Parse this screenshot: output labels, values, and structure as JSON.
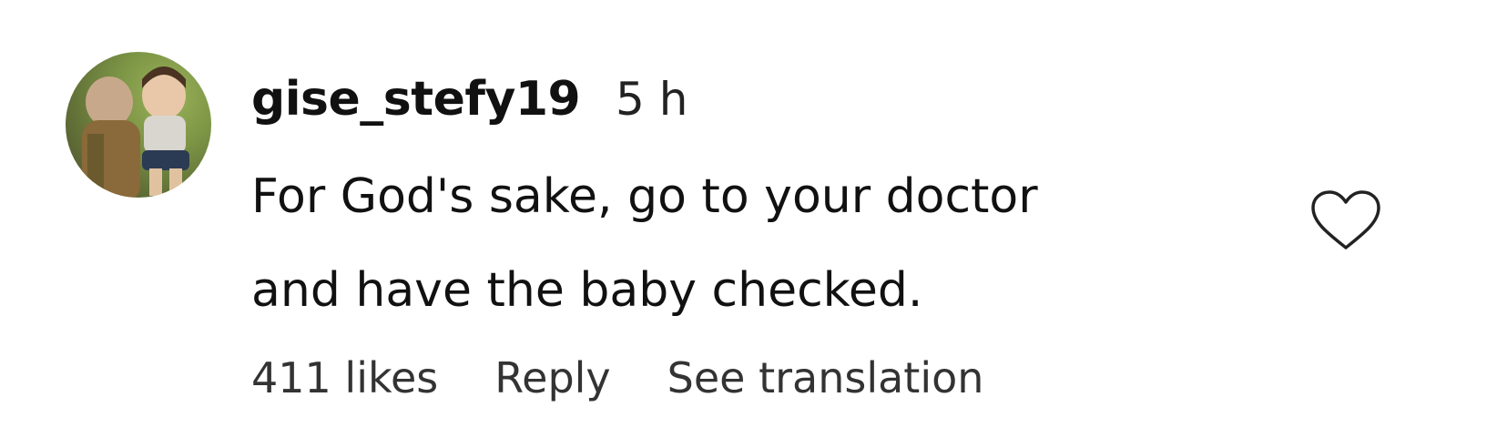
{
  "comment": {
    "username": "gise_stefy19",
    "time": "5 h",
    "text_lines": [
      "For God's sake, go to your doctor",
      "and have the baby checked."
    ],
    "likes": "411 likes",
    "reply_label": "Reply",
    "translate_label": "See translation",
    "like_icon": "heart-outline-icon"
  }
}
